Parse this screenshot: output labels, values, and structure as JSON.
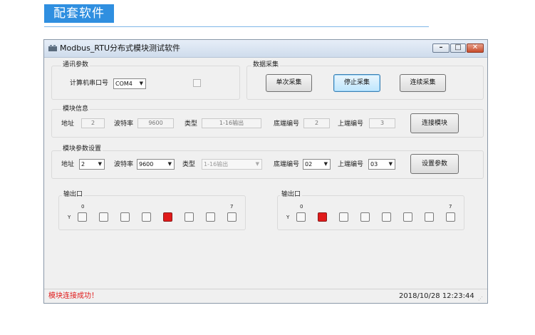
{
  "page": {
    "heading": "配套软件"
  },
  "window": {
    "title": "Modbus_RTU分布式模块测试软件",
    "icons": {
      "app": "app-icon",
      "minimize": "minimize-icon",
      "maximize": "maximize-icon",
      "close": "close-icon"
    }
  },
  "comm": {
    "group_label": "通讯参数",
    "port_label": "计算机串口号",
    "port_value": "COM4"
  },
  "collect": {
    "group_label": "数据采集",
    "single_button": "单次采集",
    "stop_button": "停止采集",
    "continuous_button": "连续采集"
  },
  "module_info": {
    "group_label": "模块信息",
    "address_label": "地址",
    "address_value": "2",
    "baud_label": "波特率",
    "baud_value": "9600",
    "type_label": "类型",
    "type_value": "1-16输出",
    "base_label": "底端编号",
    "base_value": "2",
    "upper_label": "上端编号",
    "upper_value": "3",
    "connect_button": "连接模块"
  },
  "module_set": {
    "group_label": "模块参数设置",
    "address_label": "地址",
    "address_value": "2",
    "baud_label": "波特率",
    "baud_value": "9600",
    "type_label": "类型",
    "type_value": "1-16输出",
    "base_label": "底端编号",
    "base_value": "02",
    "upper_label": "上端编号",
    "upper_value": "03",
    "set_button": "设置参数"
  },
  "output_left": {
    "group_label": "输出口",
    "start_index": "0",
    "end_index": "7",
    "row_label": "Y",
    "states": [
      false,
      false,
      false,
      false,
      true,
      false,
      false,
      false
    ]
  },
  "output_right": {
    "group_label": "输出口",
    "start_index": "0",
    "end_index": "7",
    "row_label": "Y",
    "states": [
      false,
      true,
      false,
      false,
      false,
      false,
      false,
      false
    ]
  },
  "status": {
    "message": "模块连接成功！",
    "datetime": "2018/10/28 12:23:44"
  },
  "colors": {
    "accent": "#2f8fe0",
    "led_on": "#e01a1a",
    "status_text": "#e01a1a"
  }
}
